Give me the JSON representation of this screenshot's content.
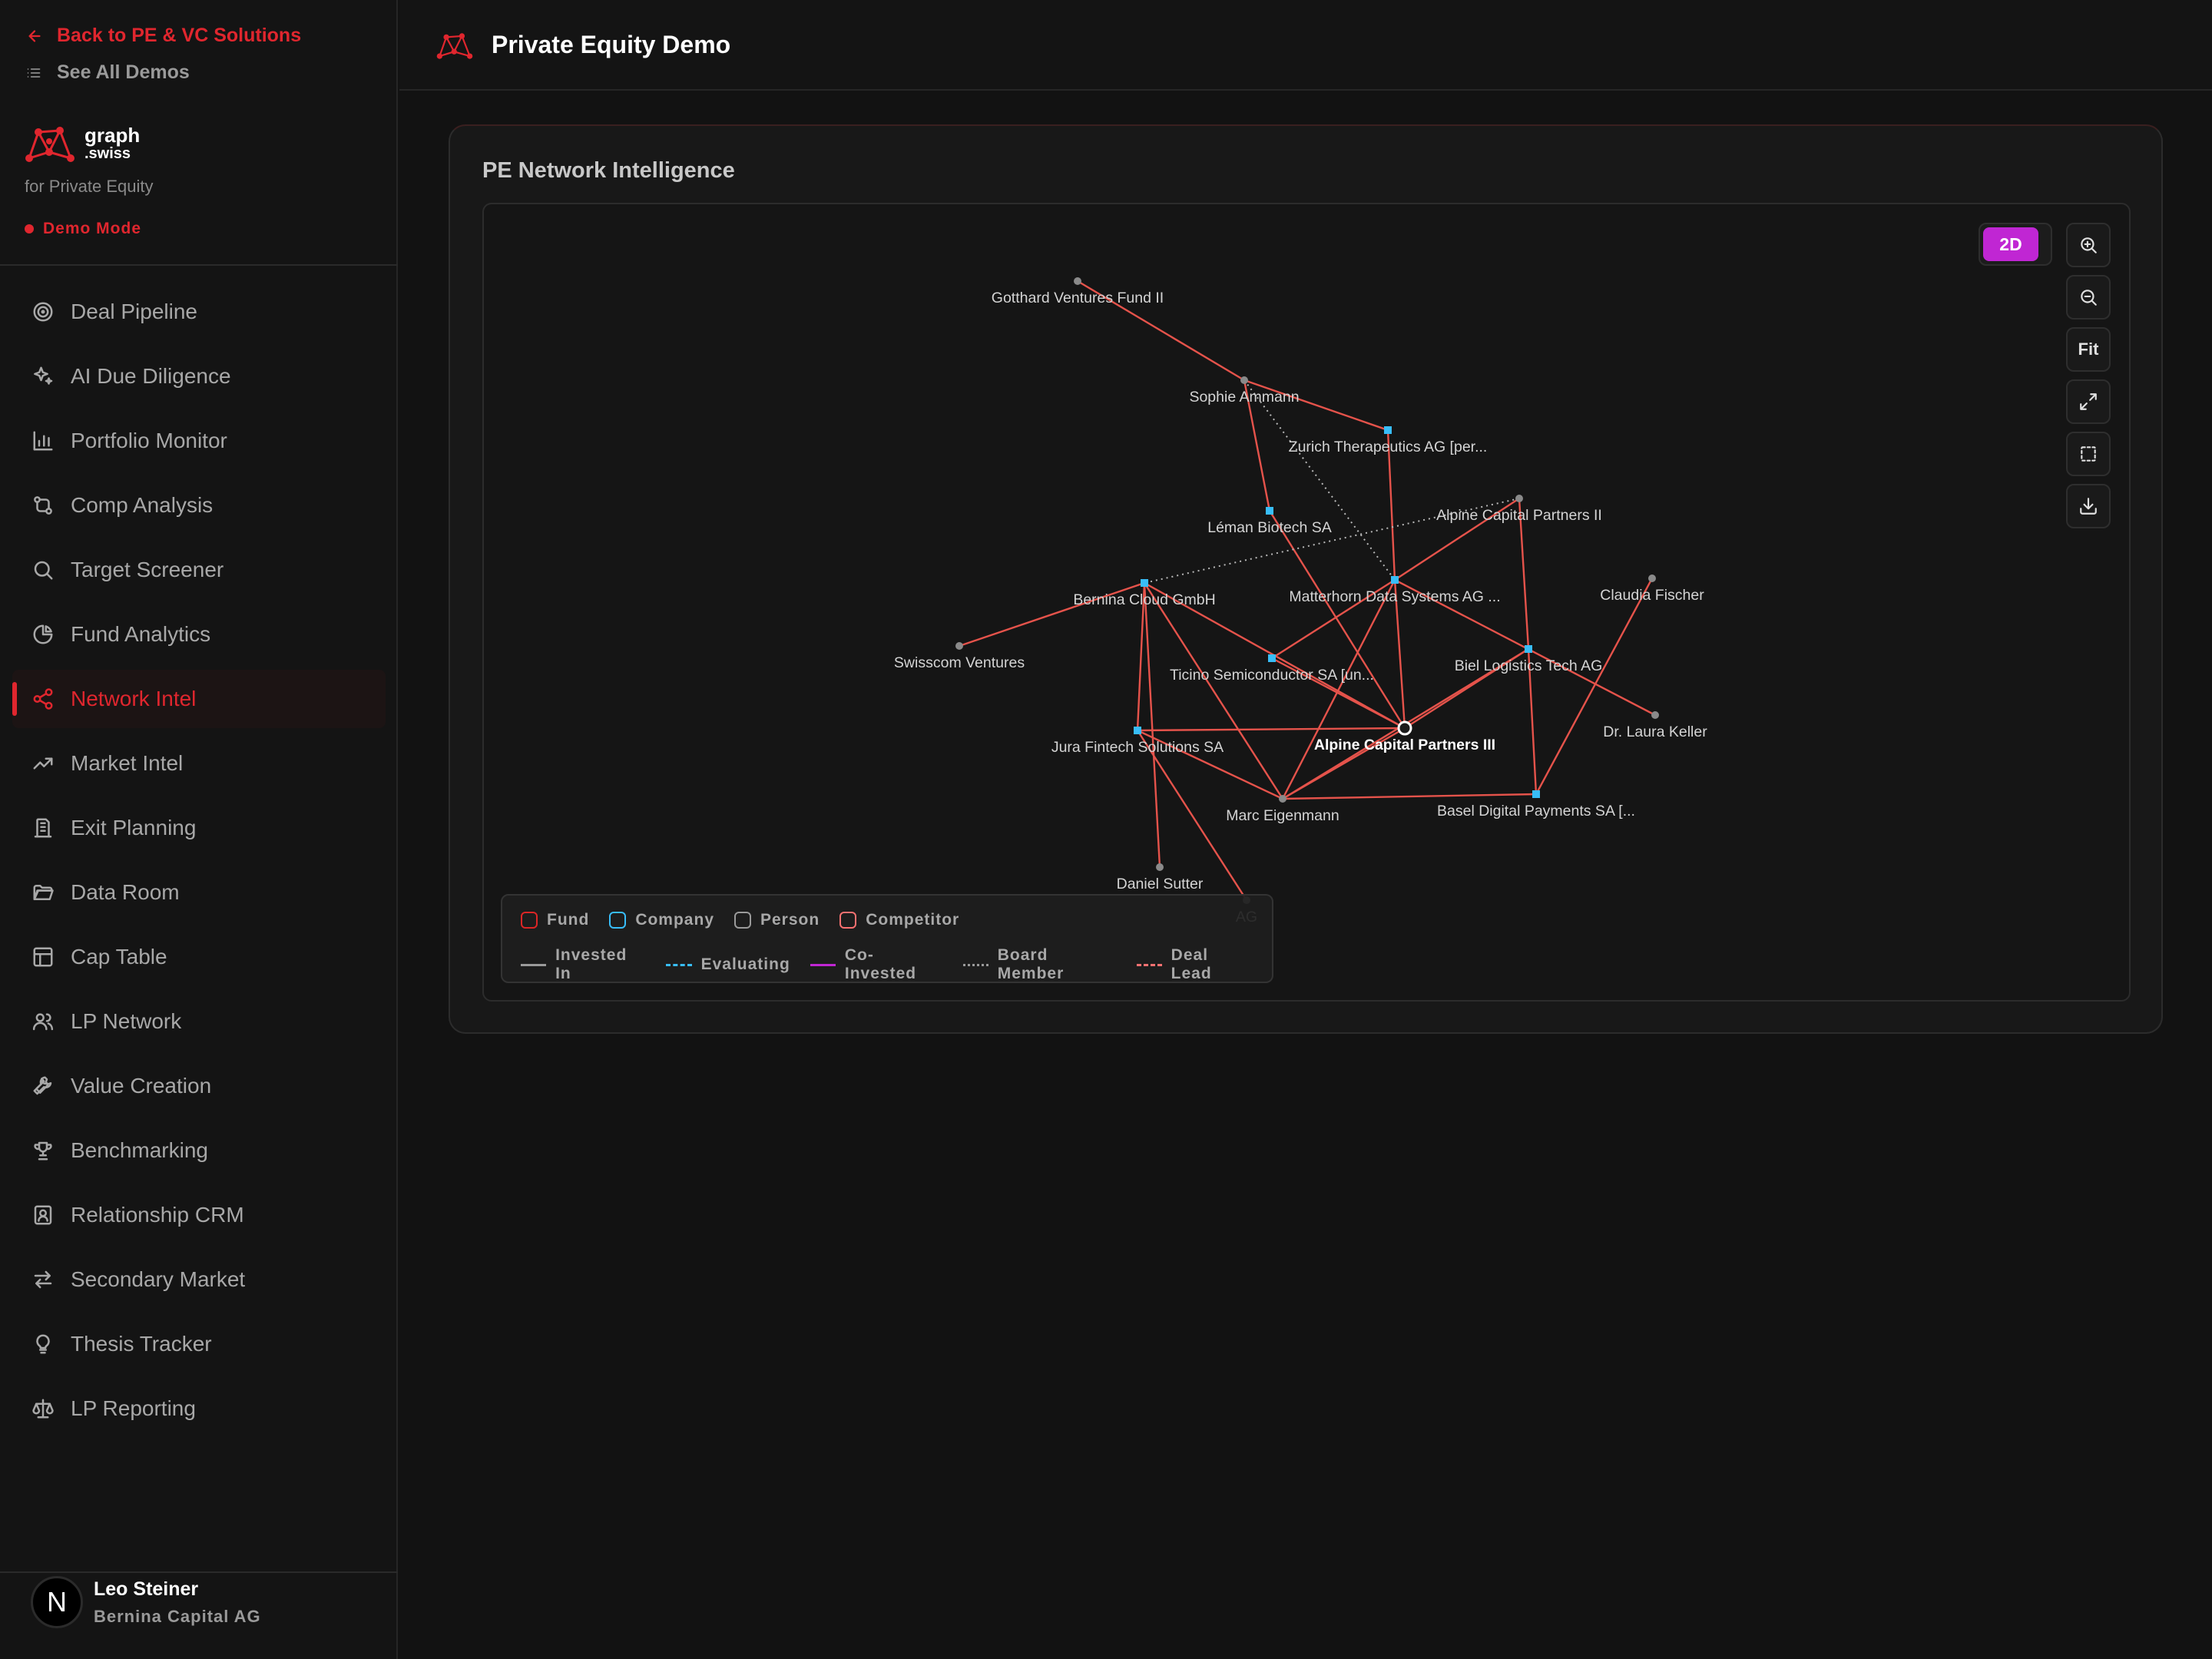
{
  "nav_top": {
    "back_label": "Back to PE & VC Solutions",
    "see_all_label": "See All Demos"
  },
  "brand": {
    "name": "graph",
    "suffix": ".swiss",
    "subtitle": "for Private Equity",
    "mode_label": "Demo Mode",
    "accent_color": "#e0262e"
  },
  "sidebar": {
    "items": [
      {
        "label": "Deal Pipeline",
        "icon": "target-icon"
      },
      {
        "label": "AI Due Diligence",
        "icon": "sparkles-icon"
      },
      {
        "label": "Portfolio Monitor",
        "icon": "bar-chart-icon"
      },
      {
        "label": "Comp Analysis",
        "icon": "git-compare-icon"
      },
      {
        "label": "Target Screener",
        "icon": "search-icon"
      },
      {
        "label": "Fund Analytics",
        "icon": "pie-chart-icon"
      },
      {
        "label": "Network Intel",
        "icon": "share-icon",
        "active": true
      },
      {
        "label": "Market Intel",
        "icon": "trending-up-icon"
      },
      {
        "label": "Exit Planning",
        "icon": "building-icon"
      },
      {
        "label": "Data Room",
        "icon": "folder-open-icon"
      },
      {
        "label": "Cap Table",
        "icon": "table-icon"
      },
      {
        "label": "LP Network",
        "icon": "users-icon"
      },
      {
        "label": "Value Creation",
        "icon": "wrench-icon"
      },
      {
        "label": "Benchmarking",
        "icon": "trophy-icon"
      },
      {
        "label": "Relationship CRM",
        "icon": "contact-icon"
      },
      {
        "label": "Secondary Market",
        "icon": "arrows-swap-icon"
      },
      {
        "label": "Thesis Tracker",
        "icon": "lightbulb-icon"
      },
      {
        "label": "LP Reporting",
        "icon": "scale-icon"
      }
    ]
  },
  "user": {
    "initial": "N",
    "name": "Leo Steiner",
    "org": "Bernina Capital AG"
  },
  "header": {
    "title": "Private Equity Demo"
  },
  "panel": {
    "title": "PE Network Intelligence",
    "mode_label": "2D",
    "fit_label": "Fit"
  },
  "graph": {
    "edge_color": "#e5534b",
    "nodes": [
      {
        "id": "gotthard",
        "label": "Gotthard Ventures Fund II",
        "type": "person"
      },
      {
        "id": "sophie",
        "label": "Sophie Ammann",
        "type": "person"
      },
      {
        "id": "zurich",
        "label": "Zurich Therapeutics AG [per...",
        "type": "company"
      },
      {
        "id": "leman",
        "label": "Léman Biotech SA",
        "type": "company"
      },
      {
        "id": "alpine2",
        "label": "Alpine Capital Partners II",
        "type": "person"
      },
      {
        "id": "bernina",
        "label": "Bernina Cloud GmbH",
        "type": "company"
      },
      {
        "id": "matterhorn",
        "label": "Matterhorn Data Systems AG ...",
        "type": "company"
      },
      {
        "id": "claudia",
        "label": "Claudia Fischer",
        "type": "person"
      },
      {
        "id": "swisscom",
        "label": "Swisscom Ventures",
        "type": "person"
      },
      {
        "id": "ticino",
        "label": "Ticino Semiconductor SA [un...",
        "type": "company"
      },
      {
        "id": "biel",
        "label": "Biel Logistics Tech AG",
        "type": "company"
      },
      {
        "id": "laura",
        "label": "Dr. Laura Keller",
        "type": "person"
      },
      {
        "id": "jura",
        "label": "Jura Fintech Solutions SA",
        "type": "company"
      },
      {
        "id": "alpine3",
        "label": "Alpine Capital Partners III",
        "type": "focus"
      },
      {
        "id": "marc",
        "label": "Marc Eigenmann",
        "type": "person"
      },
      {
        "id": "basel",
        "label": "Basel Digital Payments SA [...",
        "type": "company"
      },
      {
        "id": "daniel",
        "label": "Daniel Sutter",
        "type": "person"
      },
      {
        "id": "ag",
        "label": "AG",
        "type": "person"
      }
    ],
    "edges": [
      {
        "from": "gotthard",
        "to": "sophie",
        "style": "solid"
      },
      {
        "from": "sophie",
        "to": "zurich",
        "style": "solid"
      },
      {
        "from": "sophie",
        "to": "leman",
        "style": "solid"
      },
      {
        "from": "sophie",
        "to": "matterhorn",
        "style": "dotted"
      },
      {
        "from": "zurich",
        "to": "matterhorn",
        "style": "solid"
      },
      {
        "from": "leman",
        "to": "alpine3",
        "style": "solid"
      },
      {
        "from": "alpine2",
        "to": "matterhorn",
        "style": "solid"
      },
      {
        "from": "alpine2",
        "to": "biel",
        "style": "solid"
      },
      {
        "from": "alpine2",
        "to": "bernina",
        "style": "dotted"
      },
      {
        "from": "swisscom",
        "to": "bernina",
        "style": "solid"
      },
      {
        "from": "bernina",
        "to": "jura",
        "style": "solid"
      },
      {
        "from": "bernina",
        "to": "alpine3",
        "style": "solid"
      },
      {
        "from": "bernina",
        "to": "marc",
        "style": "solid"
      },
      {
        "from": "bernina",
        "to": "daniel",
        "style": "solid"
      },
      {
        "from": "matterhorn",
        "to": "ticino",
        "style": "solid"
      },
      {
        "from": "matterhorn",
        "to": "alpine3",
        "style": "solid"
      },
      {
        "from": "matterhorn",
        "to": "marc",
        "style": "solid"
      },
      {
        "from": "matterhorn",
        "to": "laura",
        "style": "solid"
      },
      {
        "from": "ticino",
        "to": "alpine3",
        "style": "solid"
      },
      {
        "from": "biel",
        "to": "alpine3",
        "style": "solid"
      },
      {
        "from": "biel",
        "to": "marc",
        "style": "solid"
      },
      {
        "from": "biel",
        "to": "basel",
        "style": "solid"
      },
      {
        "from": "claudia",
        "to": "basel",
        "style": "solid"
      },
      {
        "from": "jura",
        "to": "alpine3",
        "style": "solid"
      },
      {
        "from": "jura",
        "to": "marc",
        "style": "solid"
      },
      {
        "from": "jura",
        "to": "ag",
        "style": "solid"
      },
      {
        "from": "alpine3",
        "to": "marc",
        "style": "solid"
      },
      {
        "from": "marc",
        "to": "basel",
        "style": "solid"
      }
    ]
  },
  "legend": {
    "node_types": [
      {
        "label": "Fund",
        "color": "#dc2626"
      },
      {
        "label": "Company",
        "color": "#38bdf8"
      },
      {
        "label": "Person",
        "color": "#9a9a9a"
      },
      {
        "label": "Competitor",
        "color": "#f87171"
      }
    ],
    "edge_types": [
      {
        "label": "Invested In",
        "color": "#9a9a9a",
        "style": "solid"
      },
      {
        "label": "Evaluating",
        "color": "#38bdf8",
        "style": "dashed"
      },
      {
        "label": "Co-Invested",
        "color": "#c026d3",
        "style": "solid"
      },
      {
        "label": "Board Member",
        "color": "#9a9a9a",
        "style": "dotted"
      },
      {
        "label": "Deal Lead",
        "color": "#f87171",
        "style": "dashed"
      }
    ]
  }
}
